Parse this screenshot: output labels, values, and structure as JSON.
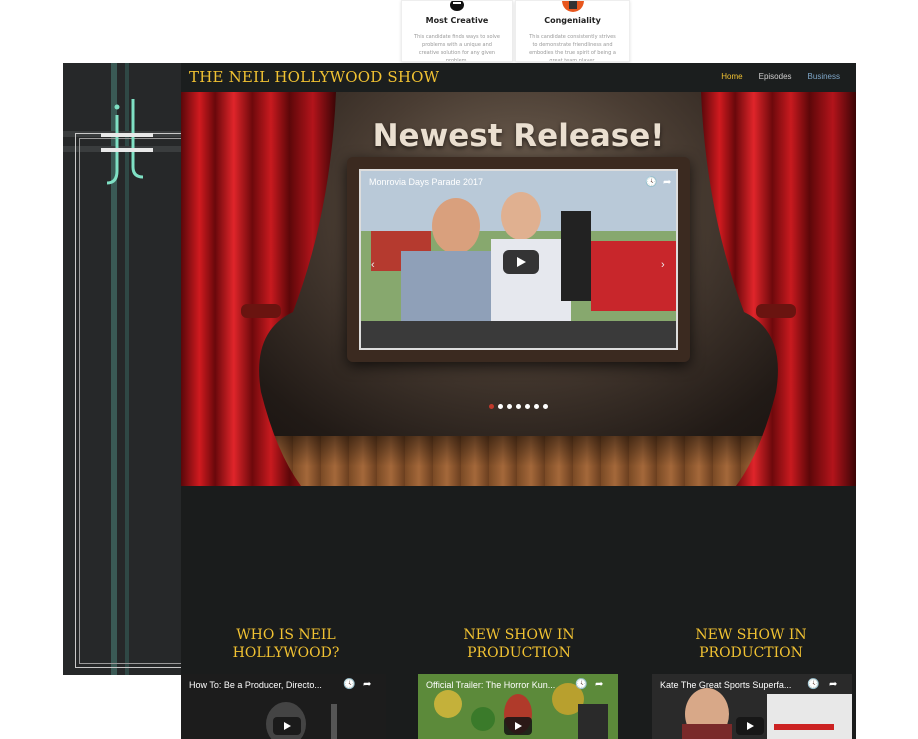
{
  "award_cards": [
    {
      "title": "Most Creative",
      "description": "This candidate finds ways to solve problems with a unique and creative solution for any given problem."
    },
    {
      "title": "Congeniality",
      "description": "This candidate consistently strives to demonstrate friendliness and embodies the true spirit of being a great team player."
    }
  ],
  "site": {
    "brand": "THE NEIL HOLLYWOOD SHOW",
    "nav": {
      "home": "Home",
      "episodes": "Episodes",
      "business": "Business"
    },
    "hero": {
      "title": "Newest Release!",
      "video_title": "Monrovia Days Parade 2017",
      "slide_count": 7,
      "active_slide": 0
    },
    "columns": [
      {
        "heading_line1": "WHO IS NEIL",
        "heading_line2": "HOLLYWOOD?",
        "video_title": "How To: Be a Producer, Directo..."
      },
      {
        "heading_line1": "NEW SHOW IN",
        "heading_line2": "PRODUCTION",
        "video_title": "Official Trailer: The Horror Kun..."
      },
      {
        "heading_line1": "NEW SHOW IN",
        "heading_line2": "PRODUCTION",
        "video_title": "Kate The Great Sports Superfa..."
      }
    ]
  },
  "colors": {
    "brand_gold": "#f1c232",
    "curtain_red": "#b3141b",
    "panel_dark": "#262829",
    "logo_mint": "#7fe0c4"
  },
  "icons": [
    "clock-icon",
    "share-icon",
    "play-icon",
    "chevron-left-icon",
    "chevron-right-icon",
    "bee-icon",
    "trophy-icon",
    "logo-monogram"
  ]
}
